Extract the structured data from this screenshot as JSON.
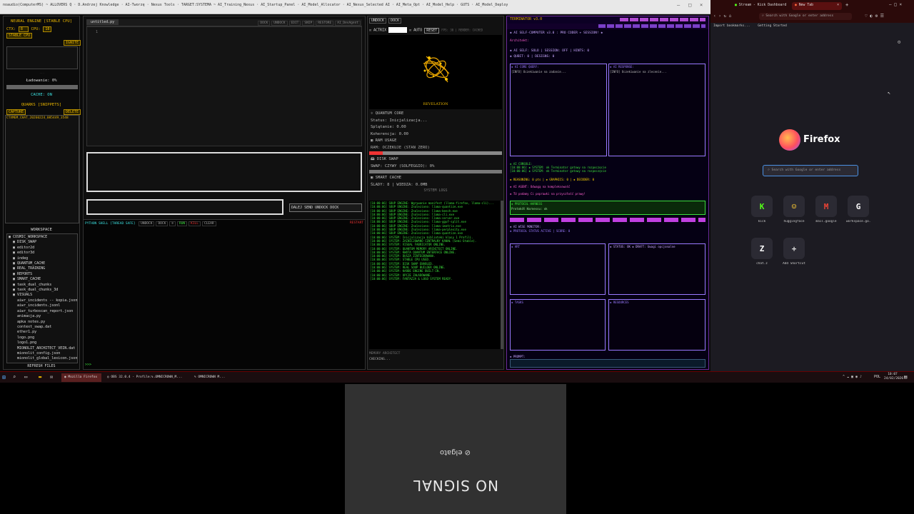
{
  "window_title": "noaudio(ComputerMS) ~ ALLOVERS Q · D.Andrzej Knowledge · AI-Tworzę · Nexus Tools · TARGET:SYSTEMA ~ AI_Training_Nexus · AI_Startup_Panel · AI_Model_Allocator · AI_Nexus_Selected AI · AI_Meta_Opt · AI_Model_Help · GUTS · AI_Model_Deploy",
  "neural": {
    "title": "NEURAL ENGINE [STABLE CPU]",
    "ctx_label": "CTX:",
    "ctx_value": "8",
    "cpu_label": "CPU:",
    "cpu_value": "18",
    "stable_chip": "STABLE CPU",
    "ignite": "IGNITE",
    "load_status": "Ładowanie: 0%",
    "cache_status": "CACHE: ON",
    "quarks_title": "QUARKS [SNIPPETS]",
    "capture": "CAPTURE",
    "delete": "DELETE",
    "snippet": "CTXMEM_CHAT_20260224_085449_3548",
    "workspace_title": "WORKSPACE",
    "tree": [
      "▣ COSMIC_WORKSPACE",
      "  ▣ DISK_SWAP",
      "  ▣ editor2d",
      "  ▣ editor3d",
      "  ▣ indeg",
      "  ▣ QUANTUM_CACHE",
      "  ▣ REAL_TRAINING",
      "  ▣ REPORTS",
      "  ▣ SMART_CACHE",
      "  ▣ task_dual_chunks",
      "  ▣ task_dual_chunks_3d",
      "  ▣ VISUALS",
      "    aiwr_incidents -- kopia.jsonl",
      "    aiwr_incidents.jsonl",
      "    aiwr_turboscan_report.json",
      "    animacja.py",
      "    apka notes.py",
      "    context_swap.dat",
      "    ether1.py",
      "    logo.png",
      "    logo1.png",
      "    MIONOLIT_ARCHITECT_VEIN.dat",
      "    mionolit_config.json",
      "    mionolit_global_lexicon.json"
    ],
    "refresh": "REFRESH FILES"
  },
  "editor": {
    "tab": "untitled.py",
    "toolbar": [
      "DOCK",
      "UNDOCK",
      "EDIT",
      "SNIP",
      "RESTORE",
      "AI_DevAgent"
    ],
    "line_no": "1",
    "action_buttons": [
      "DALEJ",
      "SEND",
      "UNDOCK",
      "DOCK"
    ],
    "shell_title": "PYTHON SHELL [THREAD SAFE]",
    "shell_buttons": [
      "UNDOCK",
      "DOCK",
      "≡",
      "RUN",
      "KILL",
      "CLEAR"
    ],
    "restart": "RESTART",
    "prompt": ">>>"
  },
  "quantum": {
    "undock": "UNDOCK",
    "dock": "DOCK",
    "actrix_label": "ACTRIX",
    "auto_label": "AUTO",
    "reset": "RESET",
    "top_flags": "FPS: 30 | RENDER: CACHED",
    "revelation": "REVELATION",
    "core_title": "QUANTUM CORE",
    "status": "Status: Inicjalizacja...",
    "splatanie": "Splątanie: 0.00",
    "koherencja": "Koherencja: 0.00",
    "ram_title": "RAM USAGE",
    "ram_line": "RAM: OCZEKUJE (STAN ZERO)",
    "disk_title": "DISK SWAP",
    "swap_line": "SWAP: CZYWY (SOLFEGGIO): 0%",
    "cache_title": "SMART CACHE",
    "cache_line": "ŚLADY: 8 | WIEDZA: 0.0MB",
    "logs_title": "SYSTEM LOGS",
    "logs": [
      "[10:00:06] SOUP ENGINE: Wgrywanie manifest (llama-firefox, llama-cli)...",
      "[10:00:06] SOUP ENGINE: Znaleziono: llama-quantize.exe",
      "[10:00:06] SOUP ENGINE: Znaleziono: llama-bench.exe",
      "[10:00:06] SOUP ENGINE: Znaleziono: llama-cli.exe",
      "[10:00:06] SOUP ENGINE: Znaleziono: llama-server.exe",
      "[10:00:06] SOUP ENGINE: Znaleziono: llama-gguf-split.exe",
      "[10:00:06] SOUP ENGINE: Znaleziono: llama-imatrix.exe",
      "[10:00:06] SOUP ENGINE: Znaleziono: llama-perplexity.exe",
      "[10:00:06] SOUP ENGINE: Znaleziono: llama-quantize.exe",
      "[10:00:06] SYSTEM: Inicjalizacja biblioteki klasy 1 Profili.",
      "[10:00:06] SYSTEM: ZAINICJOWANO CENTRALNY KANAŁ (Semi-Stable).",
      "[10:00:06] SYSTEM: VISUAL FABRICATOR ONLINE.",
      "[10:00:06] SYSTEM: QUANTUM MEMORY ARCHITECT ONLINE.",
      "[10:00:06] SYSTEM: KWOTA QUANTUM ENTERFACE ONLINE.",
      "[10:00:06] SYSTEM: DUSZA ZINTEGROWANA.",
      "[10:00:06] SYSTEM: STABLE CPU USED.",
      "[10:00:06] SYSTEM: DISK SWAP ENABLED.",
      "[10:00:06] SYSTEM: REAL SOUP BUILDER ONLINE.",
      "[10:00:06] SYSTEM: KARDE ENGINE BUILT-IN.",
      "[10:00:06] SYSTEM: OPCJE ZAŁADOWANE.",
      "[10:00:06] SYSTEM: FANTAZJA & LOGO SYSTEM READY."
    ],
    "memory_label": "MEMORY ARCHITECT",
    "checking": "CHECKING..."
  },
  "terminal": {
    "title": "TERMINATOR v3.0",
    "header_line": "◈ AI SELF-COMPUTER v3.0 : PRO CODER + SESSION! ◈",
    "arch_line": "Architekt:",
    "self_line": "◈ AI SELF: SOLO | SESSION: OFF | HINTS: 0",
    "status_line": "◈ QUBIT: 0 | DESIGNS: 0",
    "pane_a": "◈ AI CORE QUERY:",
    "pane_b": "◈ AI RESPONSE:",
    "pane_a_text": "[INFO] Oczekiwanie na zadanie...",
    "pane_b_text": "[INFO] Oczekiwanie na zlecenie...",
    "console_lines": [
      "◈ AI CONSOLE:",
      "[10:00:06] ◈ SYSTEM: ok Terminator gotowy na rozpoczęcie",
      "[10:00:06] ◈ SYSTEM: ok Terminator gotowy na rozpoczęcie"
    ],
    "reasoning_line": "◈ REASONING: 0 pts | ◈ GRAPHICS: 0 | ◈ DECODER: 0",
    "agent_line": "◈ AI AGENT: Odwagą na kompleksowość",
    "suggest_line": "◈ TU podamy Ci poprawki na przyszłość prawy!",
    "module_title": "◈ PROTOCOL HARNESS",
    "module_text": "Protokół Harnessu: ok",
    "wise_title": "◈ AI WISE MONITOR:",
    "wise_text": "◈ PROTOCOL STATUS ACTIVE | SCORE: 0",
    "lower_a": "◈ ART",
    "lower_b": "◈ STATUS: OK ◈ DRAFT: Uwagi opcjonalne",
    "lower_c": "◈ TASKS",
    "lower_d": "◈ RESOURCES",
    "input_label": "◈ PROMPT:"
  },
  "firefox": {
    "tabs": [
      "Stream - Kick Dashboard",
      "New Tab"
    ],
    "url_placeholder": "Search with Google or enter address",
    "bookmarks": [
      "Import bookmarks...",
      "Getting Started"
    ],
    "brand": "Firefox",
    "search_placeholder": "Search with Google or enter address",
    "shortcuts": [
      {
        "label": "kick",
        "letter": "K",
        "color": "#53fc18"
      },
      {
        "label": "huggingface",
        "letter": "☺",
        "color": "#ffcc33"
      },
      {
        "label": "mail.google",
        "letter": "M",
        "color": "#ea4335"
      },
      {
        "label": "workspace.go...",
        "letter": "G",
        "color": "#ffffff"
      }
    ],
    "shortcuts2": [
      {
        "label": "chat.z",
        "letter": "Z",
        "color": "#ffffff"
      },
      {
        "label": "Add Shortcut",
        "letter": "+",
        "color": "#dddddd"
      }
    ]
  },
  "taskbar": {
    "items": [
      "Mozilla Firefox",
      "OBS 32.0.4 - Profile:...",
      "OMNICROWN_M...",
      "OMNICROWN M..."
    ],
    "lang": "POL",
    "time": "10:07",
    "date": "24/02/2026"
  },
  "nosignal": {
    "brand": "elgato",
    "message": "NO SIGNAL"
  }
}
